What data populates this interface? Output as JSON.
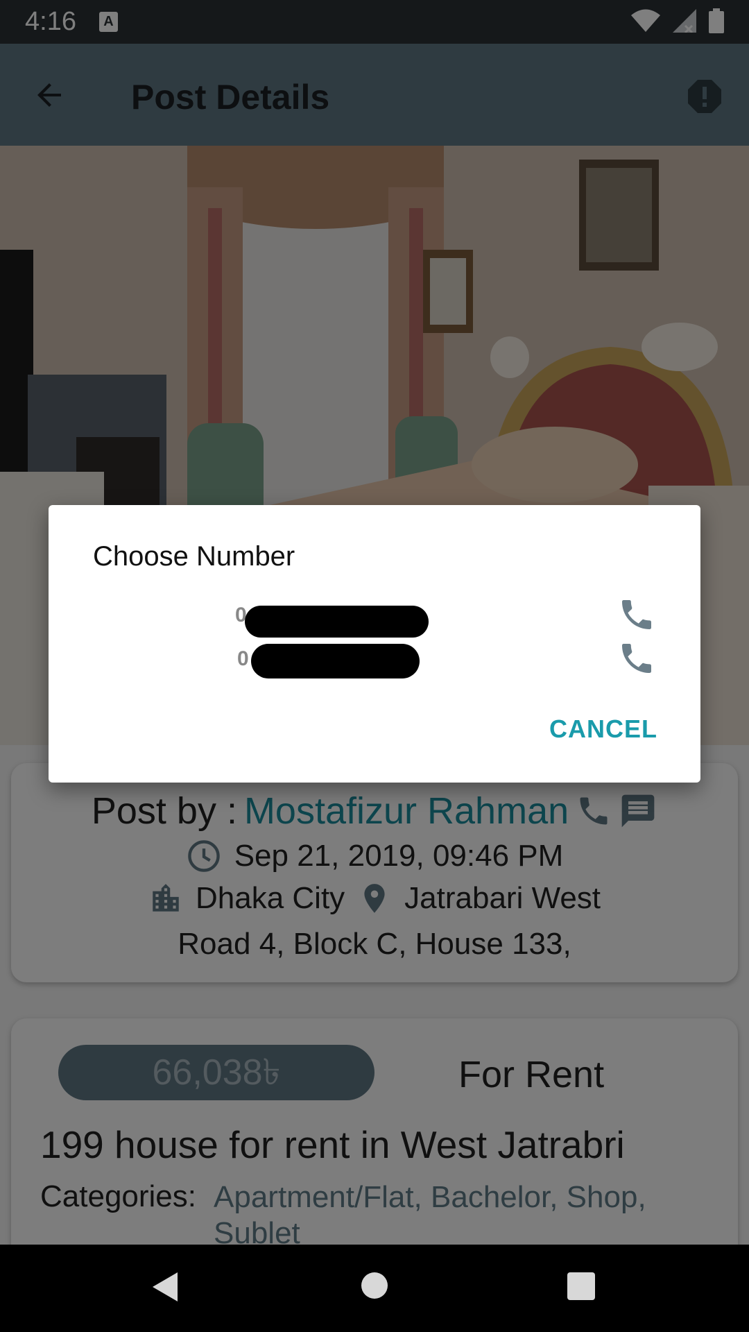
{
  "status_bar": {
    "time": "4:16",
    "notification_icon": "A"
  },
  "app_bar": {
    "title": "Post Details"
  },
  "post_info": {
    "post_by_label": "Post by :",
    "author": "Mostafizur Rahman",
    "date": "Sep 21, 2019, 09:46 PM",
    "city": "Dhaka City",
    "area": "Jatrabari West",
    "address": "Road 4, Block C, House 133,"
  },
  "listing": {
    "price": "66,038৳",
    "type": "For Rent",
    "title": "199 house for rent in West Jatrabri",
    "categories_label": "Categories:",
    "categories": "Apartment/Flat, Bachelor, Shop, Sublet"
  },
  "dialog": {
    "title": "Choose Number",
    "numbers": [
      "0",
      "0"
    ],
    "cancel_label": "CANCEL"
  },
  "colors": {
    "primary": "#5f7683",
    "accent": "#1a9bab",
    "link": "#1a8a9a"
  }
}
